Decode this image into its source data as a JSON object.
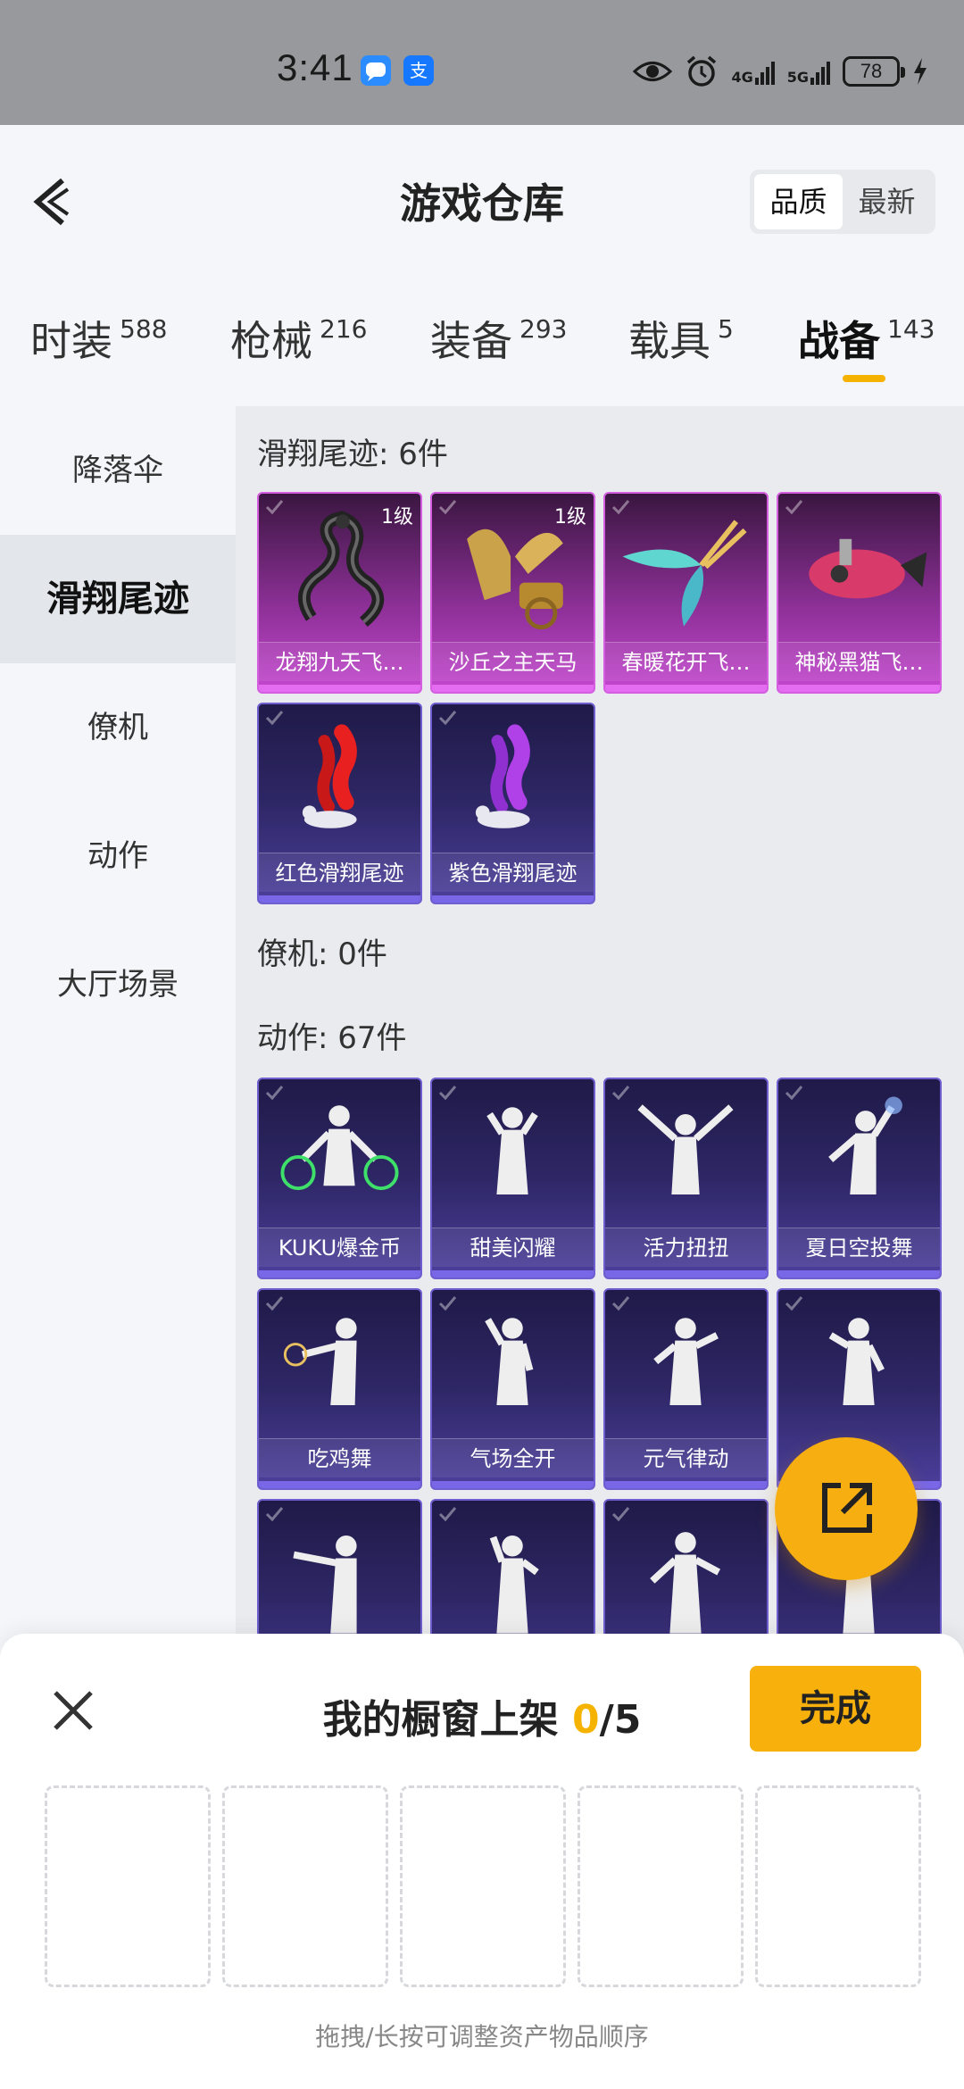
{
  "status_bar": {
    "time": "3:41",
    "apps": [
      "message-app-icon",
      "alipay-icon"
    ],
    "alipay_glyph": "支",
    "network1": "4G",
    "network2": "5G",
    "battery": "78"
  },
  "header": {
    "title": "游戏仓库",
    "sort_options": [
      "品质",
      "最新"
    ],
    "sort_active": "品质"
  },
  "tabs": [
    {
      "label": "时装",
      "count": "588"
    },
    {
      "label": "枪械",
      "count": "216"
    },
    {
      "label": "装备",
      "count": "293"
    },
    {
      "label": "载具",
      "count": "5"
    },
    {
      "label": "战备",
      "count": "143"
    }
  ],
  "sidebar": {
    "items": [
      "降落伞",
      "滑翔尾迹",
      "僚机",
      "动作",
      "大厅场景"
    ],
    "active": "滑翔尾迹"
  },
  "sections": {
    "trails": {
      "title": "滑翔尾迹: 6件",
      "items": [
        {
          "name": "龙翔九天飞…",
          "level": "1级",
          "color": "#c447cf"
        },
        {
          "name": "沙丘之主天马",
          "level": "1级",
          "color": "#c447cf"
        },
        {
          "name": "春暖花开飞…",
          "level": "",
          "color": "#c447cf"
        },
        {
          "name": "神秘黑猫飞…",
          "level": "",
          "color": "#c447cf"
        },
        {
          "name": "红色滑翔尾迹",
          "level": "",
          "color": "#4b3f9c"
        },
        {
          "name": "紫色滑翔尾迹",
          "level": "",
          "color": "#4b3f9c"
        }
      ]
    },
    "wingman": {
      "title": "僚机: 0件"
    },
    "emotes": {
      "title": "动作: 67件",
      "items": [
        {
          "name": "KUKU爆金币"
        },
        {
          "name": "甜美闪耀"
        },
        {
          "name": "活力扭扭"
        },
        {
          "name": "夏日空投舞"
        },
        {
          "name": "吃鸡舞"
        },
        {
          "name": "气场全开"
        },
        {
          "name": "元气律动"
        }
      ]
    }
  },
  "bottom_sheet": {
    "title_prefix": "我的橱窗上架 ",
    "count": "0",
    "title_suffix": "/5",
    "done_label": "完成",
    "hint": "拖拽/长按可调整资产物品顺序"
  },
  "colors": {
    "accent": "#f5b300",
    "rare_pink": "#c447cf",
    "epic_purple": "#4b3f9c"
  }
}
